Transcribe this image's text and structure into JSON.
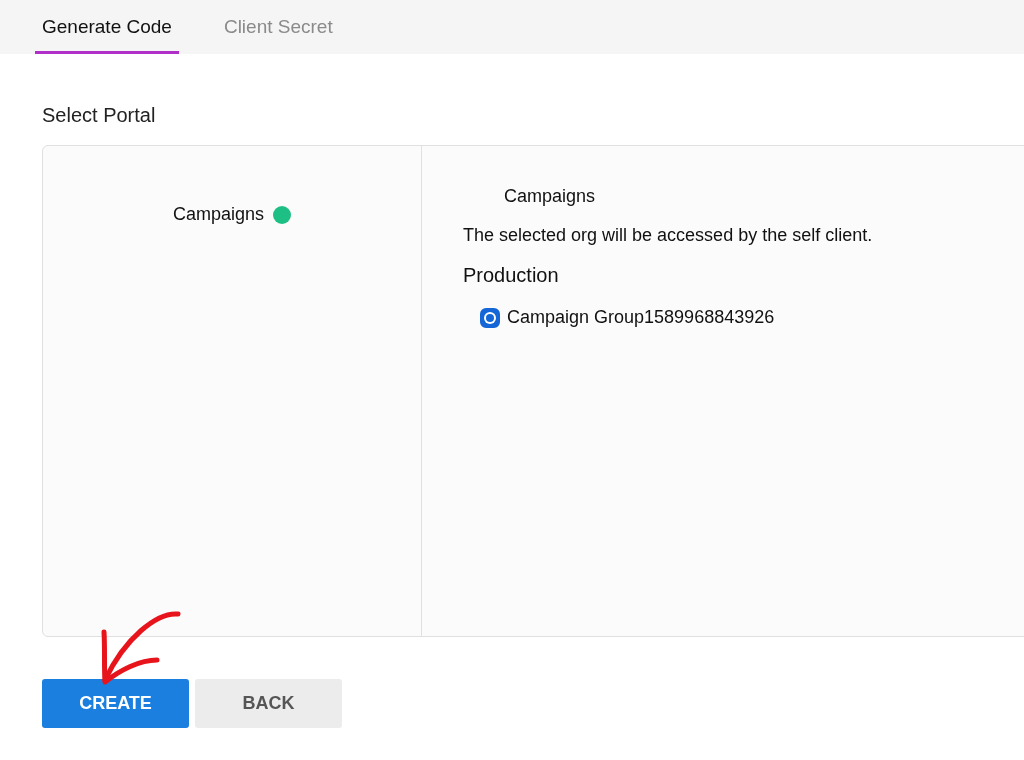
{
  "tabs": [
    {
      "label": "Generate Code",
      "selected": true
    },
    {
      "label": "Client Secret",
      "selected": false
    }
  ],
  "section_title": "Select Portal",
  "portals": [
    {
      "name": "Campaigns",
      "color": "#1dbf84"
    }
  ],
  "details": {
    "title": "Campaigns",
    "description": "The selected org will be accessed by the self client.",
    "environment": "Production",
    "orgs": [
      {
        "name": "Campaign Group1589968843926",
        "selected": true
      }
    ]
  },
  "buttons": [
    {
      "label": "CREATE",
      "kind": "primary"
    },
    {
      "label": "BACK",
      "kind": "secondary"
    }
  ]
}
